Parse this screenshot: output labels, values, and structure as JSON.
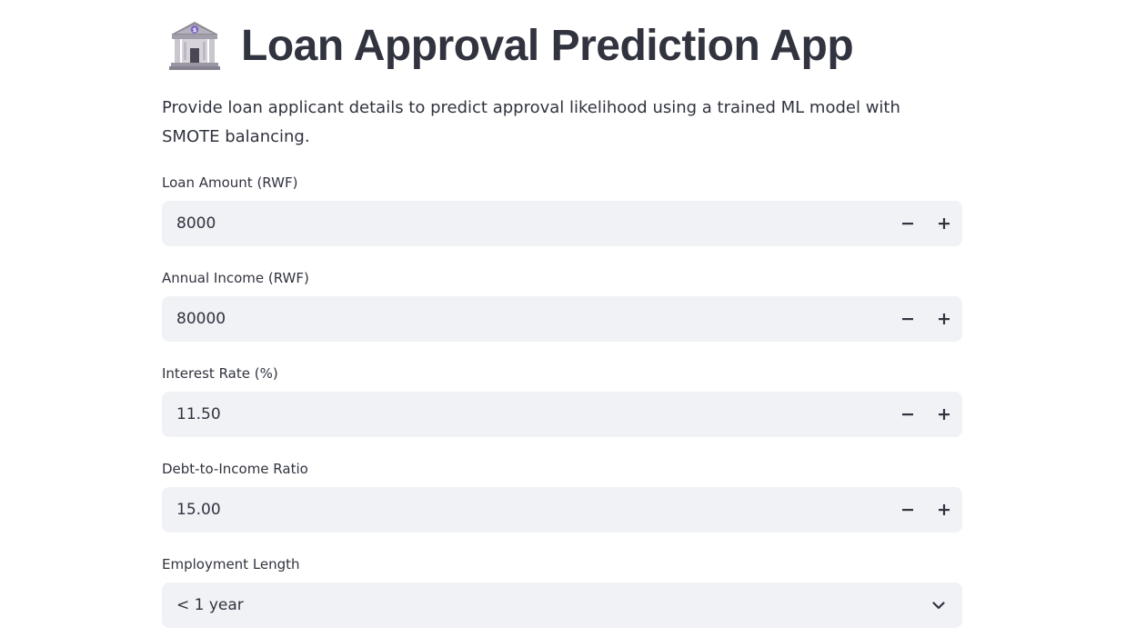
{
  "header": {
    "icon": "bank-building-icon",
    "title": "Loan Approval Prediction App"
  },
  "description": "Provide loan applicant details to predict approval likelihood using a trained ML model with SMOTE balancing.",
  "fields": [
    {
      "label": "Loan Amount (RWF)",
      "value": "8000",
      "type": "number"
    },
    {
      "label": "Annual Income (RWF)",
      "value": "80000",
      "type": "number"
    },
    {
      "label": "Interest Rate (%)",
      "value": "11.50",
      "type": "number"
    },
    {
      "label": "Debt-to-Income Ratio",
      "value": "15.00",
      "type": "number"
    },
    {
      "label": "Employment Length",
      "value": "< 1 year",
      "type": "select"
    }
  ],
  "colors": {
    "text": "#31333f",
    "input_bg": "#f0f2f6"
  }
}
